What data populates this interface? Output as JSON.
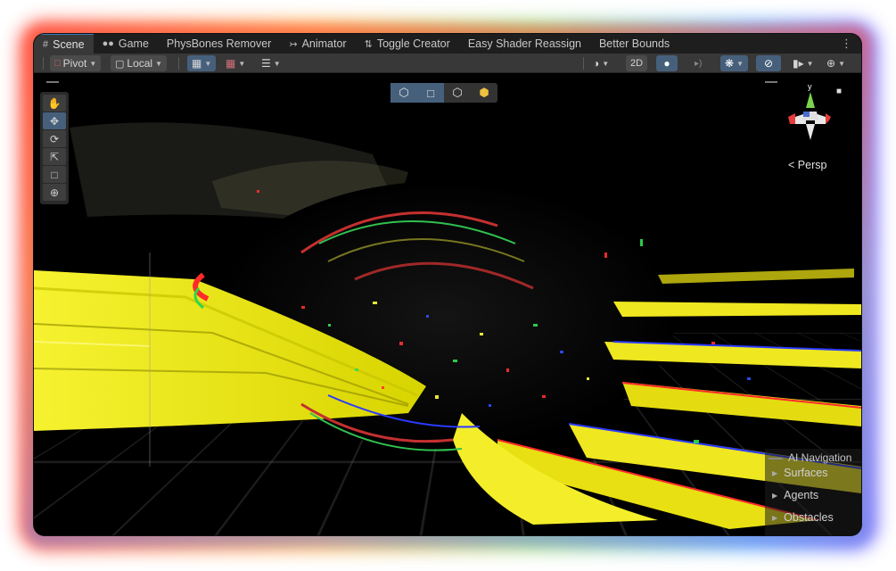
{
  "tabs": [
    {
      "label": "Scene",
      "icon": "grid-icon"
    },
    {
      "label": "Game",
      "icon": "gamepad-icon"
    },
    {
      "label": "PhysBones Remover",
      "icon": ""
    },
    {
      "label": "Animator",
      "icon": "animator-icon"
    },
    {
      "label": "Toggle Creator",
      "icon": "sliders-icon"
    },
    {
      "label": "Easy Shader Reassign",
      "icon": ""
    },
    {
      "label": "Better Bounds",
      "icon": ""
    }
  ],
  "toolbar": {
    "pivot_label": "Pivot",
    "local_label": "Local",
    "mode_2d_label": "2D"
  },
  "viewport": {
    "persp_label": "Persp",
    "gizmo_axis_label": "y",
    "accent_color": "#46607c"
  },
  "ai_navigation": {
    "title": "AI Navigation",
    "items": [
      "Surfaces",
      "Agents",
      "Obstacles"
    ]
  }
}
